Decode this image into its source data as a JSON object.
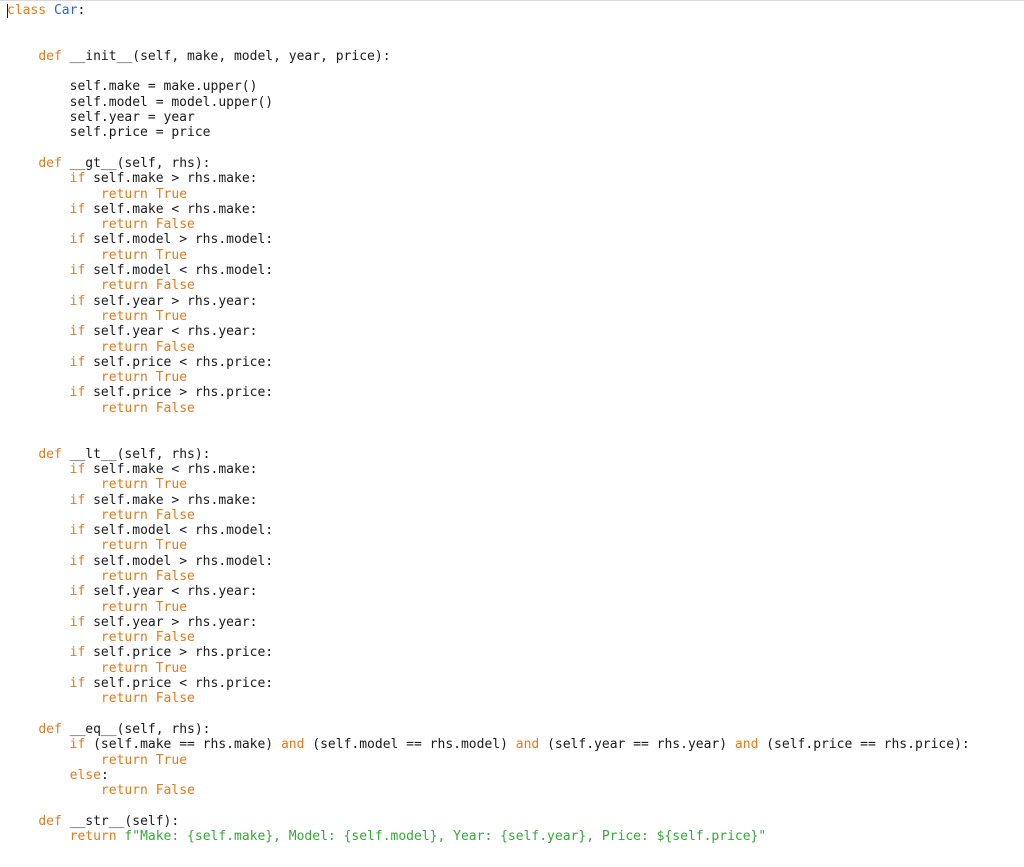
{
  "editor": {
    "lines": [
      [
        {
          "t": "class",
          "c": "kw"
        },
        {
          "t": " "
        },
        {
          "t": "Car",
          "c": "cls"
        },
        {
          "t": ":"
        }
      ],
      [],
      [],
      [
        {
          "t": "    "
        },
        {
          "t": "def",
          "c": "kw"
        },
        {
          "t": " __init__(self, make, model, year, price):"
        }
      ],
      [],
      [
        {
          "t": "        self.make = make.upper()"
        }
      ],
      [
        {
          "t": "        self.model = model.upper()"
        }
      ],
      [
        {
          "t": "        self.year = year"
        }
      ],
      [
        {
          "t": "        self.price = price"
        }
      ],
      [],
      [
        {
          "t": "    "
        },
        {
          "t": "def",
          "c": "kw"
        },
        {
          "t": " __gt__(self, rhs):"
        }
      ],
      [
        {
          "t": "        "
        },
        {
          "t": "if",
          "c": "kw"
        },
        {
          "t": " self.make > rhs.make:"
        }
      ],
      [
        {
          "t": "            "
        },
        {
          "t": "return True",
          "c": "kw"
        }
      ],
      [
        {
          "t": "        "
        },
        {
          "t": "if",
          "c": "kw"
        },
        {
          "t": " self.make < rhs.make:"
        }
      ],
      [
        {
          "t": "            "
        },
        {
          "t": "return False",
          "c": "kw"
        }
      ],
      [
        {
          "t": "        "
        },
        {
          "t": "if",
          "c": "kw"
        },
        {
          "t": " self.model > rhs.model:"
        }
      ],
      [
        {
          "t": "            "
        },
        {
          "t": "return True",
          "c": "kw"
        }
      ],
      [
        {
          "t": "        "
        },
        {
          "t": "if",
          "c": "kw"
        },
        {
          "t": " self.model < rhs.model:"
        }
      ],
      [
        {
          "t": "            "
        },
        {
          "t": "return False",
          "c": "kw"
        }
      ],
      [
        {
          "t": "        "
        },
        {
          "t": "if",
          "c": "kw"
        },
        {
          "t": " self.year > rhs.year:"
        }
      ],
      [
        {
          "t": "            "
        },
        {
          "t": "return True",
          "c": "kw"
        }
      ],
      [
        {
          "t": "        "
        },
        {
          "t": "if",
          "c": "kw"
        },
        {
          "t": " self.year < rhs.year:"
        }
      ],
      [
        {
          "t": "            "
        },
        {
          "t": "return False",
          "c": "kw"
        }
      ],
      [
        {
          "t": "        "
        },
        {
          "t": "if",
          "c": "kw"
        },
        {
          "t": " self.price < rhs.price:"
        }
      ],
      [
        {
          "t": "            "
        },
        {
          "t": "return True",
          "c": "kw"
        }
      ],
      [
        {
          "t": "        "
        },
        {
          "t": "if",
          "c": "kw"
        },
        {
          "t": " self.price > rhs.price:"
        }
      ],
      [
        {
          "t": "            "
        },
        {
          "t": "return False",
          "c": "kw"
        }
      ],
      [],
      [],
      [
        {
          "t": "    "
        },
        {
          "t": "def",
          "c": "kw"
        },
        {
          "t": " __lt__(self, rhs):"
        }
      ],
      [
        {
          "t": "        "
        },
        {
          "t": "if",
          "c": "kw"
        },
        {
          "t": " self.make < rhs.make:"
        }
      ],
      [
        {
          "t": "            "
        },
        {
          "t": "return True",
          "c": "kw"
        }
      ],
      [
        {
          "t": "        "
        },
        {
          "t": "if",
          "c": "kw"
        },
        {
          "t": " self.make > rhs.make:"
        }
      ],
      [
        {
          "t": "            "
        },
        {
          "t": "return False",
          "c": "kw"
        }
      ],
      [
        {
          "t": "        "
        },
        {
          "t": "if",
          "c": "kw"
        },
        {
          "t": " self.model < rhs.model:"
        }
      ],
      [
        {
          "t": "            "
        },
        {
          "t": "return True",
          "c": "kw"
        }
      ],
      [
        {
          "t": "        "
        },
        {
          "t": "if",
          "c": "kw"
        },
        {
          "t": " self.model > rhs.model:"
        }
      ],
      [
        {
          "t": "            "
        },
        {
          "t": "return False",
          "c": "kw"
        }
      ],
      [
        {
          "t": "        "
        },
        {
          "t": "if",
          "c": "kw"
        },
        {
          "t": " self.year < rhs.year:"
        }
      ],
      [
        {
          "t": "            "
        },
        {
          "t": "return True",
          "c": "kw"
        }
      ],
      [
        {
          "t": "        "
        },
        {
          "t": "if",
          "c": "kw"
        },
        {
          "t": " self.year > rhs.year:"
        }
      ],
      [
        {
          "t": "            "
        },
        {
          "t": "return False",
          "c": "kw"
        }
      ],
      [
        {
          "t": "        "
        },
        {
          "t": "if",
          "c": "kw"
        },
        {
          "t": " self.price > rhs.price:"
        }
      ],
      [
        {
          "t": "            "
        },
        {
          "t": "return True",
          "c": "kw"
        }
      ],
      [
        {
          "t": "        "
        },
        {
          "t": "if",
          "c": "kw"
        },
        {
          "t": " self.price < rhs.price:"
        }
      ],
      [
        {
          "t": "            "
        },
        {
          "t": "return False",
          "c": "kw"
        }
      ],
      [],
      [
        {
          "t": "    "
        },
        {
          "t": "def",
          "c": "kw"
        },
        {
          "t": " __eq__(self, rhs):"
        }
      ],
      [
        {
          "t": "        "
        },
        {
          "t": "if",
          "c": "kw"
        },
        {
          "t": " (self.make == rhs.make) "
        },
        {
          "t": "and",
          "c": "kw"
        },
        {
          "t": " (self.model == rhs.model) "
        },
        {
          "t": "and",
          "c": "kw"
        },
        {
          "t": " (self.year == rhs.year) "
        },
        {
          "t": "and",
          "c": "kw"
        },
        {
          "t": " (self.price == rhs.price):"
        }
      ],
      [
        {
          "t": "            "
        },
        {
          "t": "return True",
          "c": "kw"
        }
      ],
      [
        {
          "t": "        "
        },
        {
          "t": "else",
          "c": "kw"
        },
        {
          "t": ":"
        }
      ],
      [
        {
          "t": "            "
        },
        {
          "t": "return False",
          "c": "kw"
        }
      ],
      [],
      [
        {
          "t": "    "
        },
        {
          "t": "def",
          "c": "kw"
        },
        {
          "t": " __str__(self):"
        }
      ],
      [
        {
          "t": "        "
        },
        {
          "t": "return",
          "c": "kw"
        },
        {
          "t": " "
        },
        {
          "t": "f\"Make: {self.make}, Model: {self.model}, Year: {self.year}, Price: ${self.price}\"",
          "c": "str"
        }
      ]
    ]
  },
  "colors": {
    "keyword": "#e07a1f",
    "class_name": "#2b5fd9",
    "string": "#36a73a",
    "text": "#1a1a1a",
    "background": "#ffffff"
  }
}
